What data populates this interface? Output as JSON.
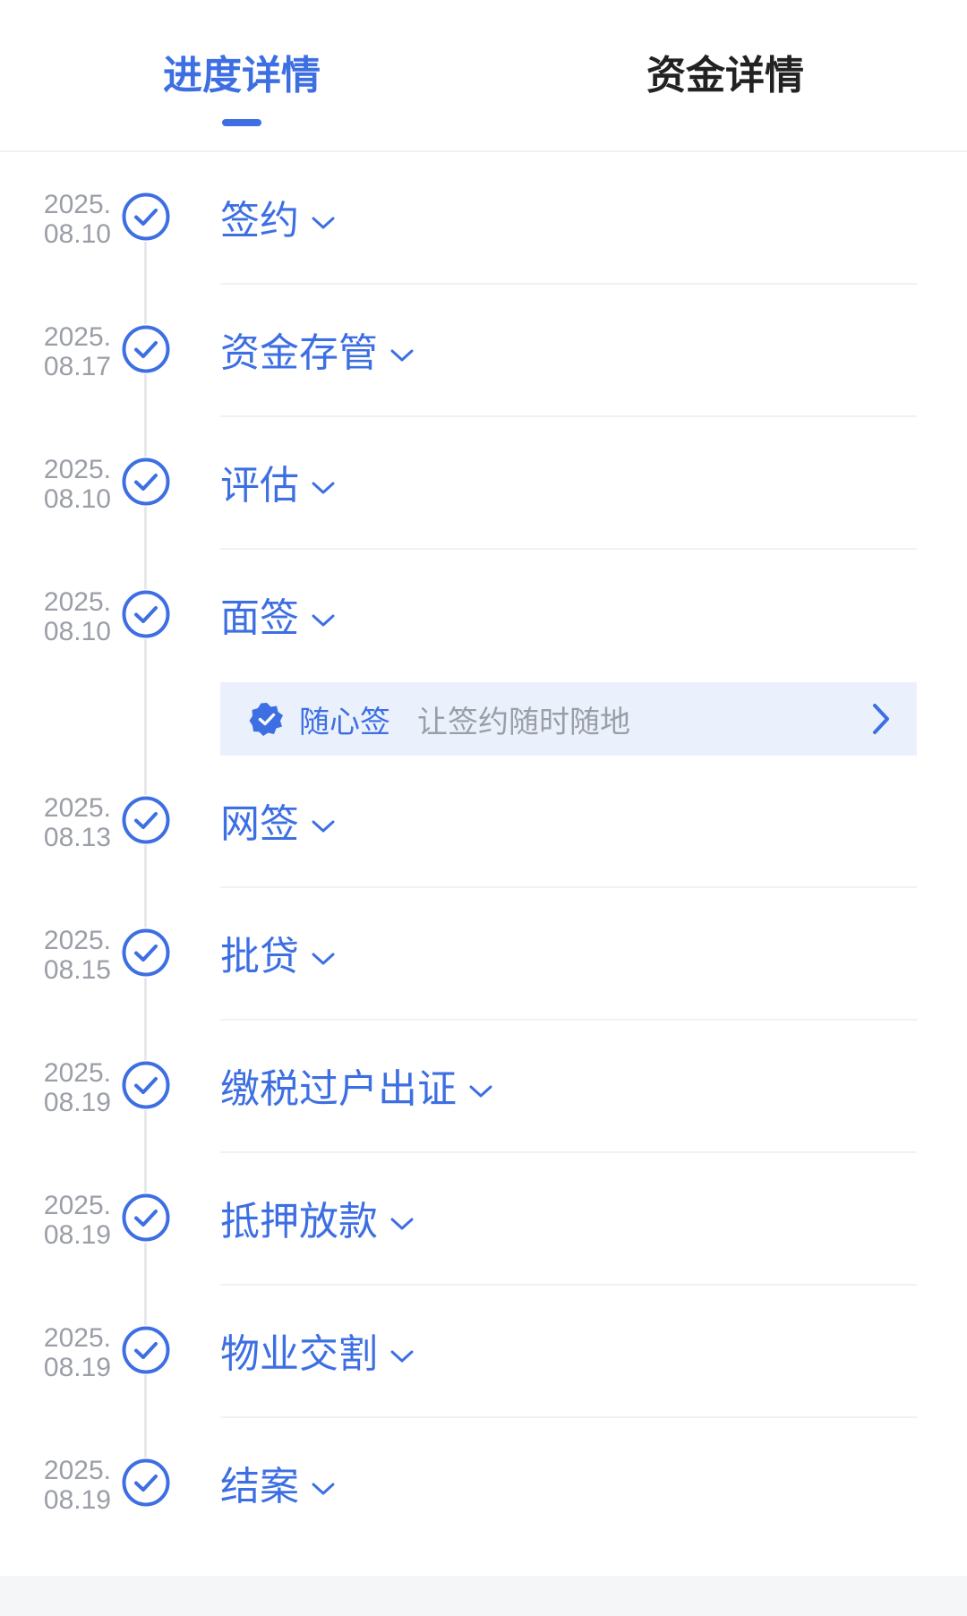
{
  "tabs": [
    {
      "label": "进度详情",
      "active": true
    },
    {
      "label": "资金详情",
      "active": false
    }
  ],
  "colors": {
    "accent": "#3d6fe3",
    "muted": "#9a9ea6"
  },
  "steps": [
    {
      "date_year": "2025.",
      "date_md": "08.10",
      "label": "签约"
    },
    {
      "date_year": "2025.",
      "date_md": "08.17",
      "label": "资金存管"
    },
    {
      "date_year": "2025.",
      "date_md": "08.10",
      "label": "评估"
    },
    {
      "date_year": "2025.",
      "date_md": "08.10",
      "label": "面签"
    },
    {
      "date_year": "2025.",
      "date_md": "08.13",
      "label": "网签"
    },
    {
      "date_year": "2025.",
      "date_md": "08.15",
      "label": "批贷"
    },
    {
      "date_year": "2025.",
      "date_md": "08.19",
      "label": "缴税过户出证"
    },
    {
      "date_year": "2025.",
      "date_md": "08.19",
      "label": "抵押放款"
    },
    {
      "date_year": "2025.",
      "date_md": "08.19",
      "label": "物业交割"
    },
    {
      "date_year": "2025.",
      "date_md": "08.19",
      "label": "结案"
    }
  ],
  "promo": {
    "title": "随心签",
    "subtitle": "让签约随时随地",
    "badge_icon": "verified-badge-icon",
    "arrow_icon": "chevron-right-icon"
  },
  "icons": {
    "step_status": "check-circle-icon",
    "expand": "chevron-down-icon"
  }
}
